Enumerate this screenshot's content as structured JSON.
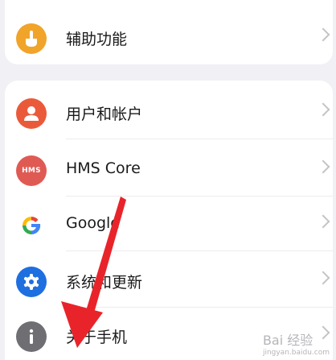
{
  "settings": {
    "items": [
      {
        "label": "辅助功能",
        "icon": "hand-pointer-icon",
        "color": "#f0a42a"
      },
      {
        "label": "用户和帐户",
        "icon": "user-icon",
        "color": "#ea5a3a"
      },
      {
        "label": "HMS Core",
        "icon": "hms-icon",
        "icon_text": "HMS",
        "color": "#e05a54"
      },
      {
        "label": "Google",
        "icon": "google-icon",
        "color": "#4285f4"
      },
      {
        "label": "系统和更新",
        "icon": "gear-icon",
        "color": "#1e6fe0"
      },
      {
        "label": "关于手机",
        "icon": "info-icon",
        "color": "#6e6e73"
      }
    ]
  },
  "overlay": {
    "annotation_color": "#e8242a"
  },
  "watermark": {
    "text": "Bai 经验",
    "subtext": "jingyan.baidu.com"
  }
}
